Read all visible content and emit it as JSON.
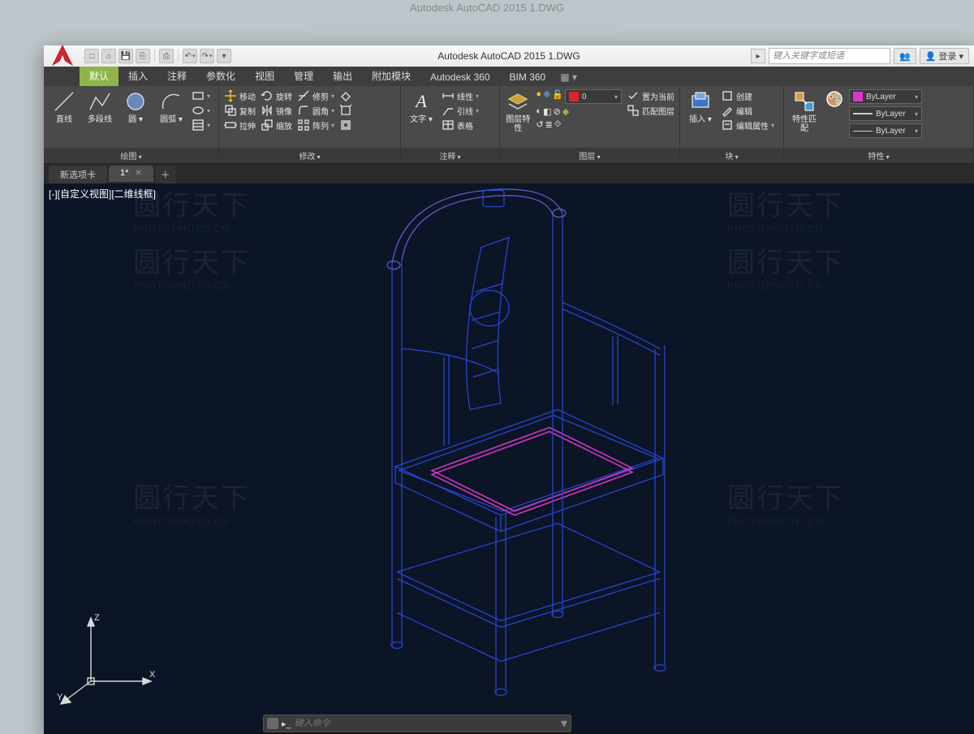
{
  "outer_title": "Autodesk AutoCAD 2015    1.DWG",
  "title": "Autodesk AutoCAD 2015    1.DWG",
  "search_placeholder": "键入关键字或短语",
  "login_label": "登录",
  "ribbon_tabs": [
    "默认",
    "插入",
    "注释",
    "参数化",
    "视图",
    "管理",
    "输出",
    "附加模块",
    "Autodesk 360",
    "BIM 360"
  ],
  "panels": {
    "draw": {
      "title": "绘图",
      "line": "直线",
      "polyline": "多段线",
      "circle": "圆",
      "arc": "圆弧"
    },
    "modify": {
      "title": "修改",
      "move": "移动",
      "copy": "复制",
      "stretch": "拉伸",
      "rotate": "旋转",
      "mirror": "镜像",
      "scale": "缩放",
      "trim": "修剪",
      "fillet": "圆角",
      "array": "阵列"
    },
    "annotate": {
      "title": "注释",
      "text": "文字",
      "linear": "线性",
      "leader": "引线",
      "table": "表格"
    },
    "layers": {
      "title": "图层",
      "props": "图层特性",
      "current": "0",
      "set_current": "置为当前",
      "match": "匹配图层"
    },
    "block": {
      "title": "块",
      "insert": "插入",
      "create": "创建",
      "edit": "编辑",
      "edit_attr": "编辑属性"
    },
    "props": {
      "title": "特性",
      "match": "特性匹配",
      "bylayer": "ByLayer"
    }
  },
  "doc_tabs": {
    "new_tab": "新选项卡",
    "file": "1*"
  },
  "view_label": "[-][自定义视图][二维线框]",
  "axes": {
    "x": "X",
    "y": "Y",
    "z": "Z"
  },
  "command_placeholder": "键入命令",
  "colors": {
    "accent_green": "#8fb54a",
    "wire_blue": "#2848d8",
    "wire_magenta": "#d838c8",
    "canvas": "#0c1526"
  }
}
